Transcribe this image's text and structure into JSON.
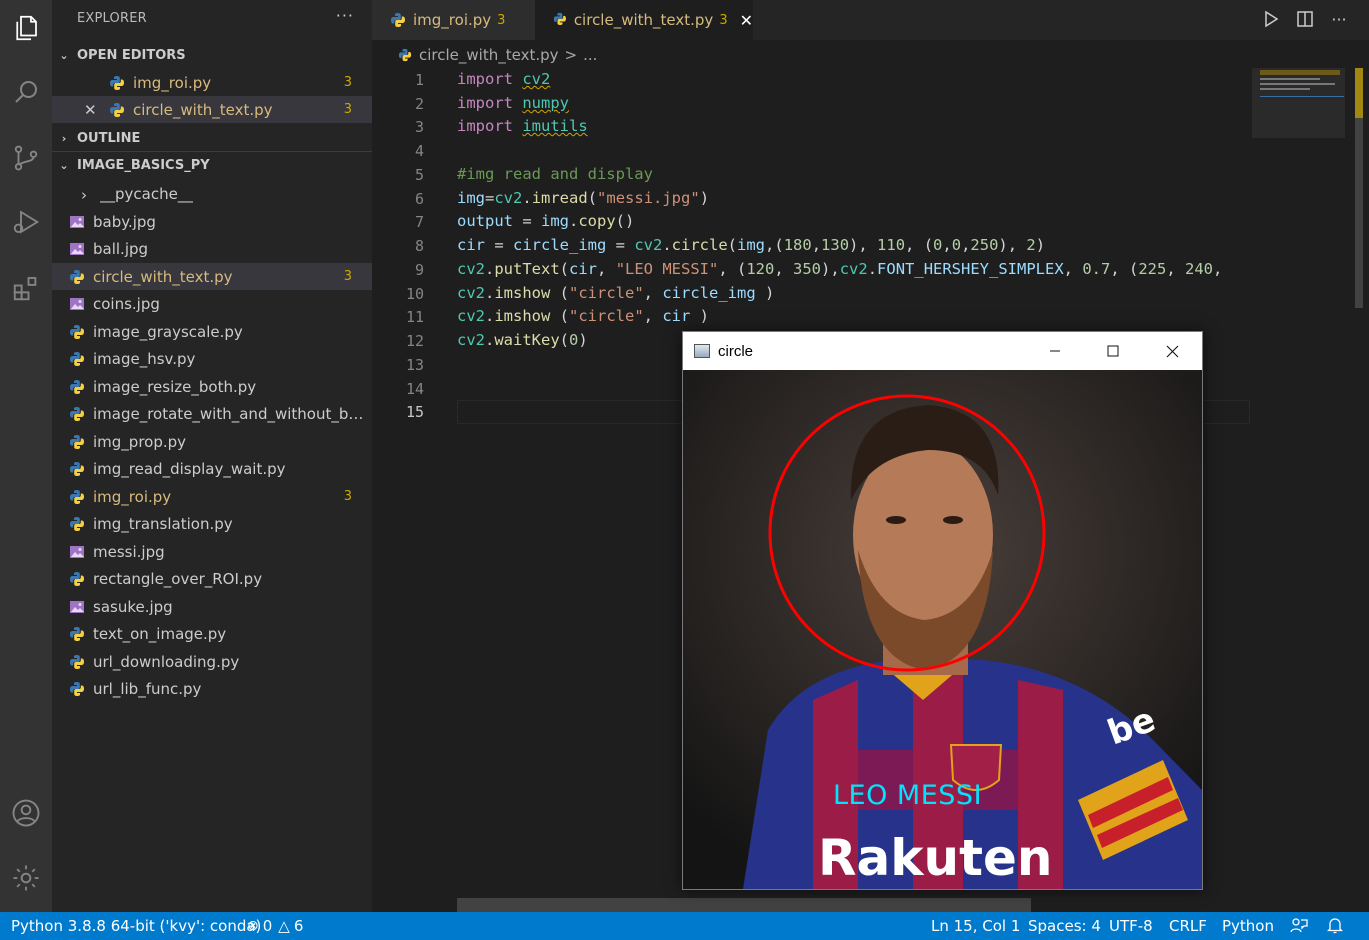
{
  "sidebar": {
    "title": "EXPLORER",
    "more": "···",
    "open_editors": {
      "label": "OPEN EDITORS",
      "items": [
        {
          "name": "img_roi.py",
          "badge": "3"
        },
        {
          "name": "circle_with_text.py",
          "badge": "3"
        }
      ]
    },
    "outline_label": "OUTLINE",
    "folder": {
      "label": "IMAGE_BASICS_PY",
      "items": [
        {
          "name": "__pycache__",
          "badge": ""
        },
        {
          "name": "baby.jpg",
          "badge": ""
        },
        {
          "name": "ball.jpg",
          "badge": ""
        },
        {
          "name": "circle_with_text.py",
          "badge": "3"
        },
        {
          "name": "coins.jpg",
          "badge": ""
        },
        {
          "name": "image_grayscale.py",
          "badge": ""
        },
        {
          "name": "image_hsv.py",
          "badge": ""
        },
        {
          "name": "image_resize_both.py",
          "badge": ""
        },
        {
          "name": "image_rotate_with_and_without_bou...",
          "badge": ""
        },
        {
          "name": "img_prop.py",
          "badge": ""
        },
        {
          "name": "img_read_display_wait.py",
          "badge": ""
        },
        {
          "name": "img_roi.py",
          "badge": "3"
        },
        {
          "name": "img_translation.py",
          "badge": ""
        },
        {
          "name": "messi.jpg",
          "badge": ""
        },
        {
          "name": "rectangle_over_ROI.py",
          "badge": ""
        },
        {
          "name": "sasuke.jpg",
          "badge": ""
        },
        {
          "name": "text_on_image.py",
          "badge": ""
        },
        {
          "name": "url_downloading.py",
          "badge": ""
        },
        {
          "name": "url_lib_func.py",
          "badge": ""
        }
      ]
    }
  },
  "tabs": [
    {
      "label": "img_roi.py",
      "count": "3"
    },
    {
      "label": "circle_with_text.py",
      "count": "3"
    }
  ],
  "breadcrumb": {
    "file": "circle_with_text.py",
    "sep": ">",
    "rest": "..."
  },
  "editor": {
    "line_numbers": [
      "1",
      "2",
      "3",
      "4",
      "5",
      "6",
      "7",
      "8",
      "9",
      "10",
      "11",
      "12",
      "13",
      "14",
      "15"
    ],
    "current_line": "15"
  },
  "cv_window": {
    "title": "circle",
    "image_caption": "LEO MESSI"
  },
  "statusbar": {
    "python": "Python 3.8.8 64-bit ('kvy': conda)",
    "errors": "0",
    "warnings": "6",
    "position": "Ln 15, Col 1",
    "spaces": "Spaces: 4",
    "encoding": "UTF-8",
    "eol": "CRLF",
    "language": "Python"
  },
  "colors": {
    "activity_bar": "#333333",
    "sidebar": "#252526",
    "editor": "#1e1e1e",
    "statusbar": "#007acc",
    "modified": "#d7ba7d",
    "circle": "#ff0000",
    "caption": "#00e5ff"
  }
}
